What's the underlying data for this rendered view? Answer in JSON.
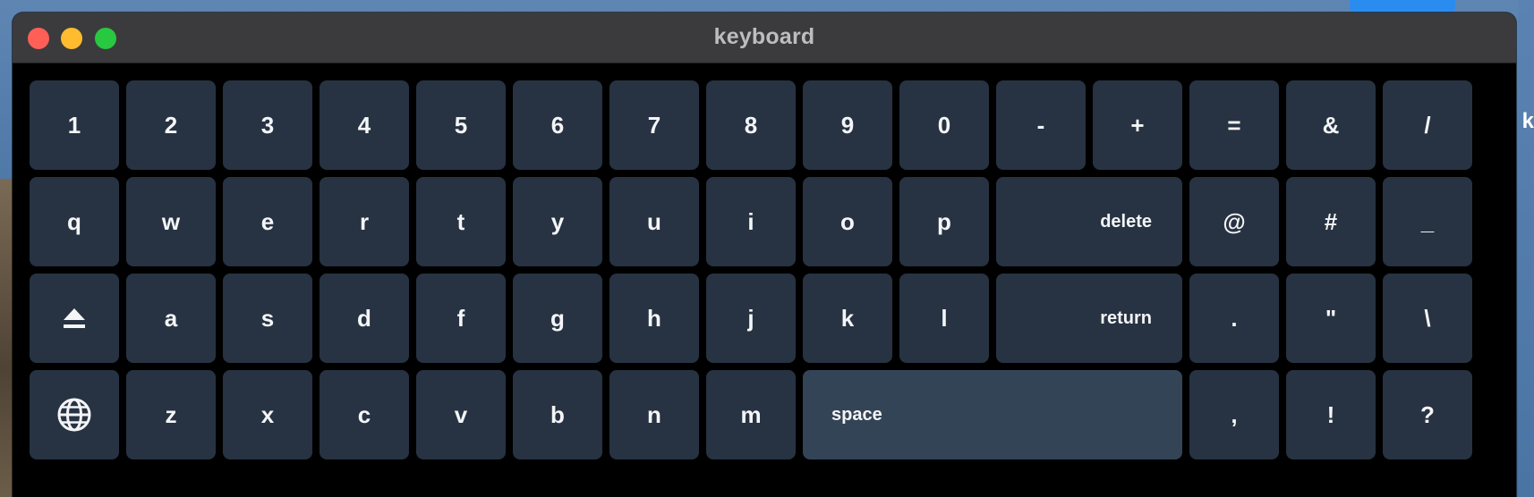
{
  "window": {
    "title": "keyboard"
  },
  "desktop": {
    "edge_text": "k"
  },
  "keyboard": {
    "row1": [
      "1",
      "2",
      "3",
      "4",
      "5",
      "6",
      "7",
      "8",
      "9",
      "0",
      "-",
      "+",
      "=",
      "&",
      "/"
    ],
    "row2": [
      "q",
      "w",
      "e",
      "r",
      "t",
      "y",
      "u",
      "i",
      "o",
      "p"
    ],
    "row2_delete": "delete",
    "row2_right": [
      "@",
      "#",
      "_"
    ],
    "row3_shift_icon": "eject-shift-icon",
    "row3": [
      "a",
      "s",
      "d",
      "f",
      "g",
      "h",
      "j",
      "k",
      "l"
    ],
    "row3_return": "return",
    "row3_right": [
      ".",
      "\"",
      "\\"
    ],
    "row4_globe_icon": "globe-icon",
    "row4": [
      "z",
      "x",
      "c",
      "v",
      "b",
      "n",
      "m"
    ],
    "row4_space": "space",
    "row4_right": [
      ",",
      "!",
      "?"
    ]
  },
  "colors": {
    "key_bg": "#273342",
    "space_bg": "#344457",
    "window_bg": "#000000",
    "titlebar_bg": "#3b3b3d",
    "close": "#ff5f57",
    "minimize": "#febc2e",
    "maximize": "#28c840"
  }
}
